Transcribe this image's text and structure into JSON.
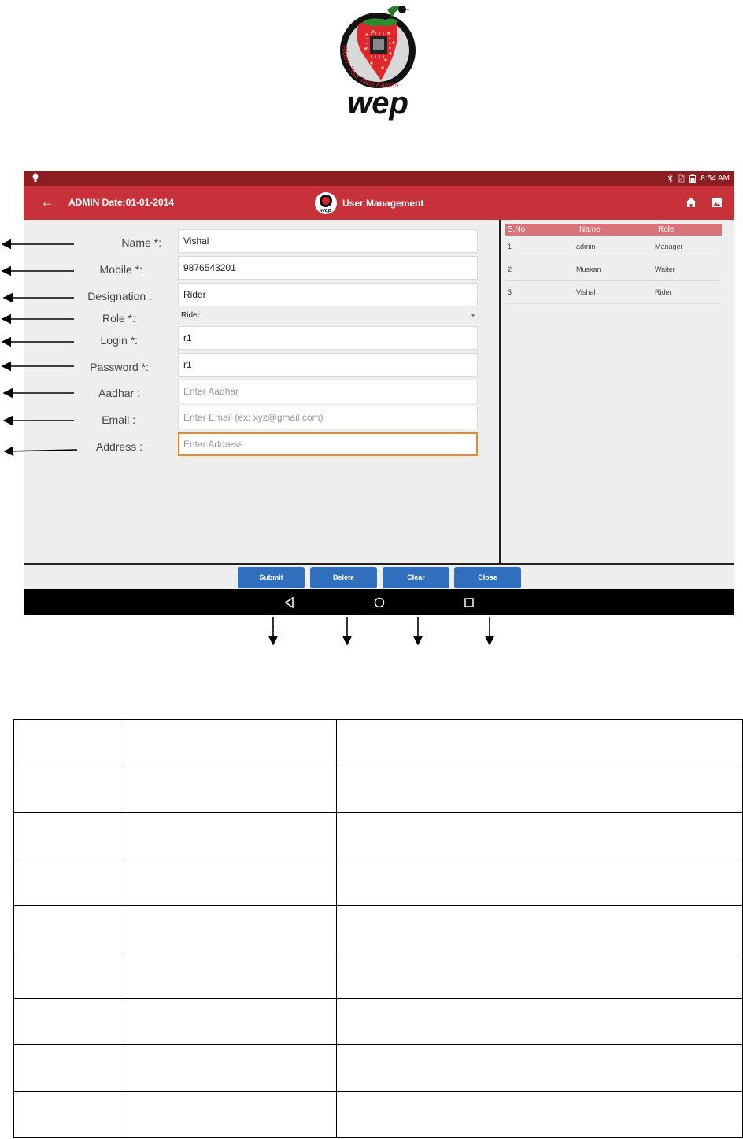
{
  "logo": {
    "brand": "wep",
    "tagline": "Bloom Your Tech Fantasy",
    "trademark": "™"
  },
  "statusbar": {
    "time": "8:54 AM"
  },
  "appbar": {
    "admin_date": "ADMIN  Date:01-01-2014",
    "title": "User Management",
    "title_logo_text": "wep"
  },
  "form": {
    "labels": {
      "name": "Name *:",
      "mobile": "Mobile *:",
      "designation": "Designation :",
      "role": "Role *:",
      "login": "Login *:",
      "password": "Password *:",
      "aadhar": "Aadhar :",
      "email": "Email :",
      "address": "Address :"
    },
    "values": {
      "name": "Vishal",
      "mobile": "9876543201",
      "designation": "Rider",
      "role": "Rider",
      "login": "r1",
      "password": "r1"
    },
    "placeholders": {
      "aadhar": "Enter Aadhar",
      "email": "Enter Email (ex: xyz@gmail.com)",
      "address": "Enter Address"
    }
  },
  "user_table": {
    "headers": [
      "S.No",
      "Name",
      "Role"
    ],
    "rows": [
      {
        "sno": "1",
        "name": "admin",
        "role": "Manager"
      },
      {
        "sno": "2",
        "name": "Muskan",
        "role": "Waiter"
      },
      {
        "sno": "3",
        "name": "Vishal",
        "role": "Rider"
      }
    ]
  },
  "buttons": {
    "submit": "Submit",
    "delete": "Delete",
    "clear": "Clear",
    "close": "Close"
  },
  "colors": {
    "statusbar": "#8e1d22",
    "appbar": "#c7323a",
    "table_header": "#d9737a",
    "button": "#2f6fbd",
    "focus_border": "#f08a1c"
  },
  "icons": [
    "back-arrow-icon",
    "home-icon",
    "gallery-icon",
    "bluetooth-icon",
    "no-sim-icon",
    "battery-icon",
    "nav-back-icon",
    "nav-home-icon",
    "nav-recents-icon"
  ]
}
